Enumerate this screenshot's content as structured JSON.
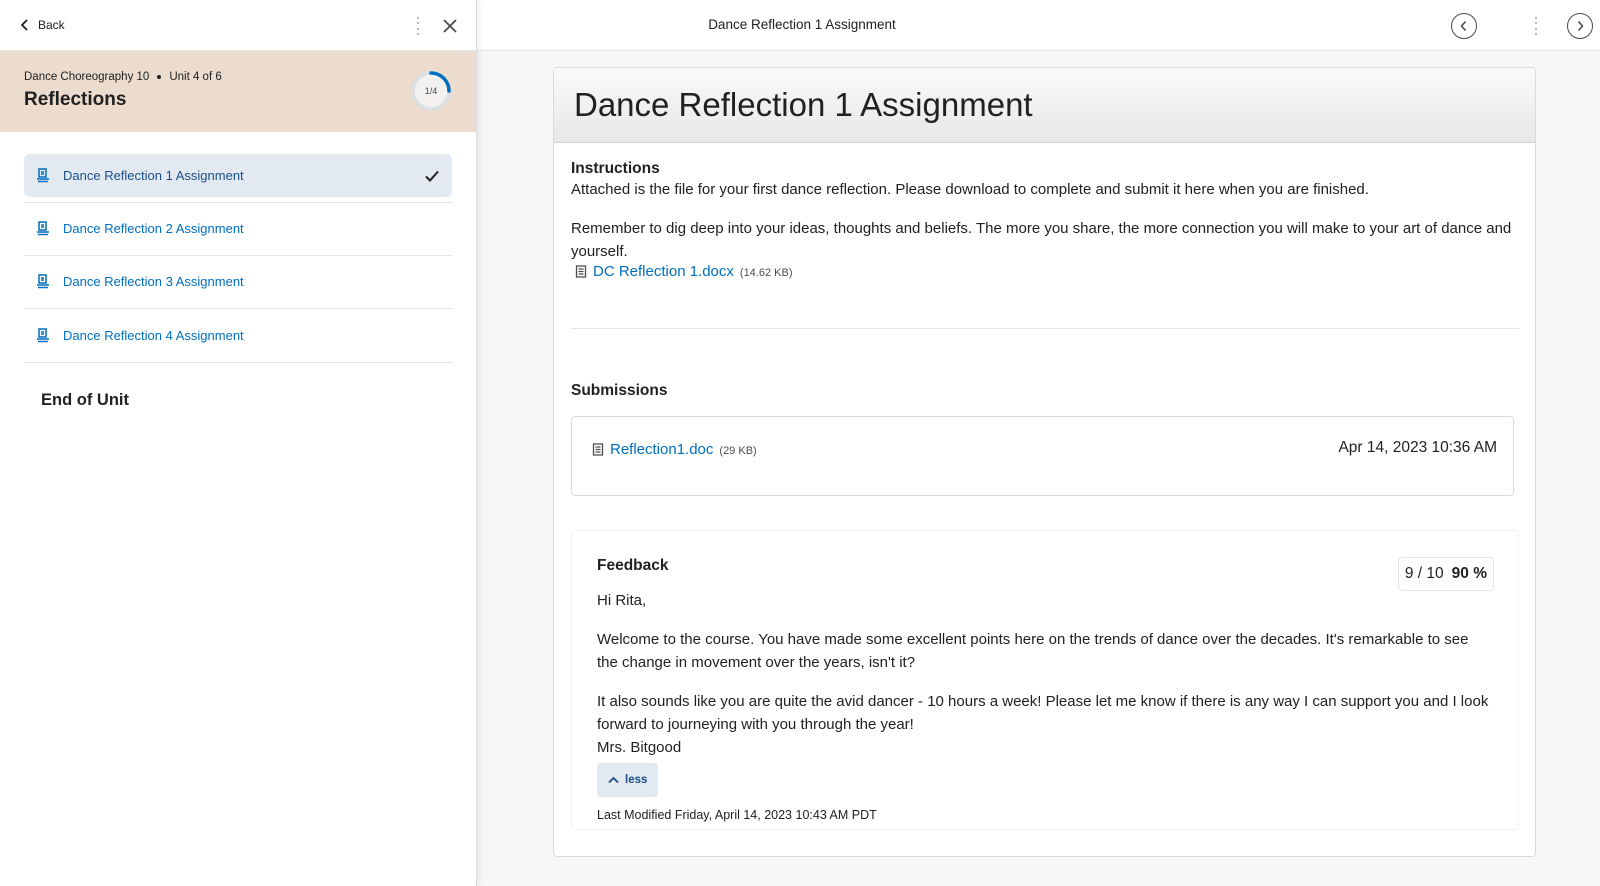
{
  "sidebar": {
    "back_label": "Back",
    "course": "Dance Choreography 10",
    "unit": "Unit 4 of 6",
    "unit_title": "Reflections",
    "progress_text": "1/4",
    "progress_fraction": 0.25,
    "items": [
      {
        "label": "Dance Reflection 1 Assignment",
        "active": true,
        "completed": true
      },
      {
        "label": "Dance Reflection 2 Assignment",
        "active": false,
        "completed": false
      },
      {
        "label": "Dance Reflection 3 Assignment",
        "active": false,
        "completed": false
      },
      {
        "label": "Dance Reflection 4 Assignment",
        "active": false,
        "completed": false
      }
    ],
    "end_label": "End of Unit"
  },
  "topbar": {
    "title": "Dance Reflection 1 Assignment"
  },
  "main": {
    "title": "Dance Reflection 1 Assignment",
    "instructions_heading": "Instructions",
    "instructions_p1": "Attached is the file for your first dance reflection. Please download to complete and submit it here when you are finished.",
    "instructions_p2": "Remember to dig deep into your ideas, thoughts and beliefs. The more you share, the more connection you will make to your art of dance and yourself.",
    "attachment_name": "DC Reflection 1.docx",
    "attachment_size": "(14.62 KB)",
    "submissions_heading": "Submissions",
    "submission_file": "Reflection1.doc",
    "submission_size": "(29 KB)",
    "submission_date": "Apr 14, 2023 10:36 AM",
    "feedback_heading": "Feedback",
    "score": "9 / 10",
    "score_percent": "90 %",
    "feedback_greeting": "Hi Rita,",
    "feedback_p1": "Welcome to the course. You have made some excellent points here on the trends of dance over the decades. It's remarkable to see the change in movement over the years, isn't it?",
    "feedback_p2": "It also sounds like you are quite the avid dancer - 10 hours a week! Please let me know if there is any way I can support you and I look forward to journeying with you through the year!",
    "feedback_signature": "Mrs. Bitgood",
    "less_label": "less",
    "last_modified": "Last Modified Friday, April 14, 2023 10:43 AM PDT"
  },
  "colors": {
    "accent": "#006fbf",
    "active_bg": "#e3e9f1",
    "unit_header_bg": "#ebdccd",
    "progress_ring": "#006fbf"
  }
}
